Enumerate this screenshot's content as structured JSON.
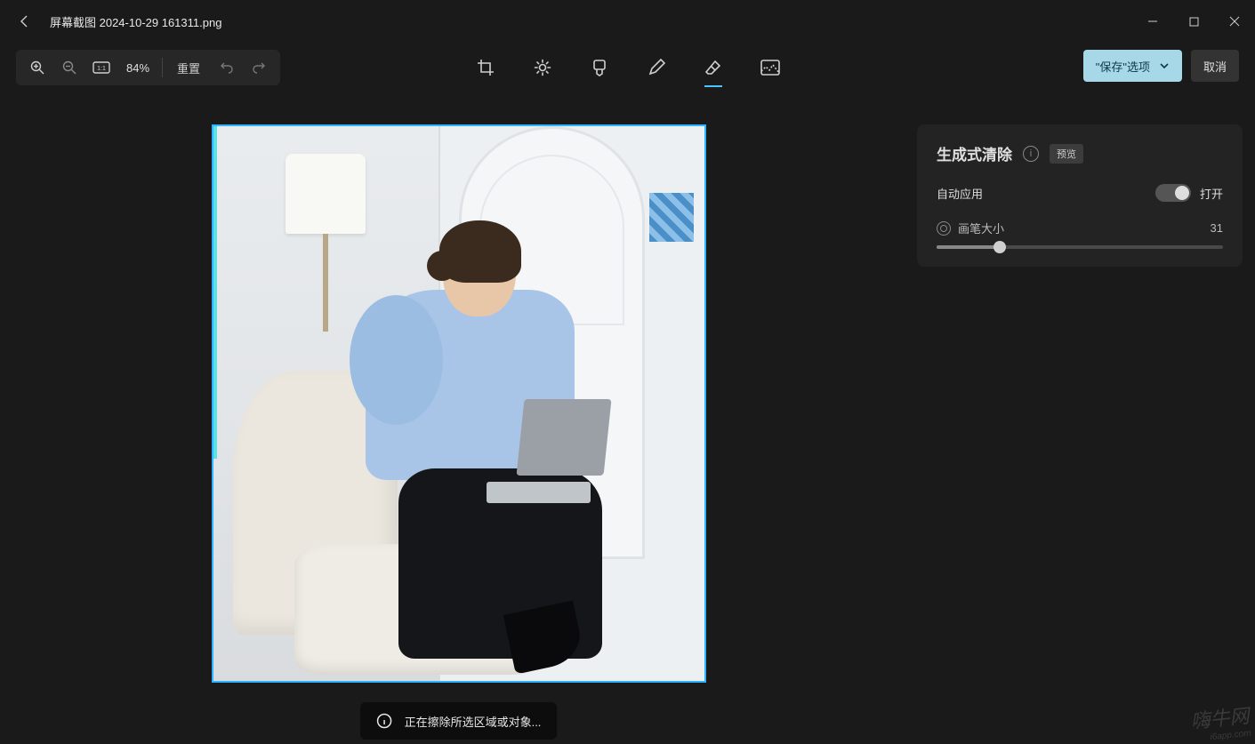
{
  "titlebar": {
    "filename": "屏幕截图 2024-10-29 161311.png"
  },
  "toolbar": {
    "zoom_pct": "84%",
    "reset": "重置"
  },
  "actions": {
    "save_options": "\"保存\"选项",
    "cancel": "取消"
  },
  "panel": {
    "title": "生成式清除",
    "preview_badge": "预览",
    "auto_apply": "自动应用",
    "auto_apply_state": "打开",
    "brush_size_label": "画笔大小",
    "brush_size_value": "31",
    "brush_slider_pct": 22
  },
  "toast": {
    "message": "正在擦除所选区域或对象..."
  },
  "watermark": {
    "line1": "嗨牛网",
    "line2": "i6app.com"
  }
}
